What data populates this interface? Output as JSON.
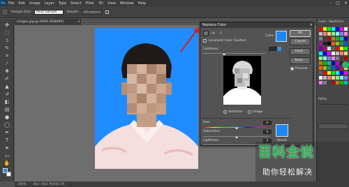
{
  "app": {
    "logo": "Ps"
  },
  "menu": [
    "File",
    "Edit",
    "Image",
    "Layer",
    "Type",
    "Select",
    "Filter",
    "3D",
    "View",
    "Window",
    "Help"
  ],
  "window_controls": [
    "–",
    "□",
    "×"
  ],
  "options_bar": {
    "sample_size_label": "Sample Size:",
    "sample_size_value": "Point Sample",
    "sample_label": "Sample:",
    "sample_value": "All Layers"
  },
  "document": {
    "tab_title": "images.jpg @ 200% (RGB/8#)",
    "zoom": "200%",
    "doc_size": "Doc: 643.7K/643.7K"
  },
  "dialog": {
    "title": "Replace Color",
    "localized_label": "Localized Color Clusters",
    "color_label": "Color:",
    "fuzziness_label": "Fuzziness:",
    "fuzziness_value": "",
    "selection_label": "Selection",
    "image_label": "Image",
    "replacement": {
      "hue_label": "Hue:",
      "hue_value": "0",
      "saturation_label": "Saturation:",
      "saturation_value": "0",
      "lightness_label": "Lightness:",
      "lightness_value": "0",
      "result_label": "Result"
    },
    "buttons": {
      "ok": "OK",
      "cancel": "Cancel",
      "load": "Load...",
      "save": "Save..."
    },
    "preview_label": "Preview",
    "color_swatch": "#1e88f0",
    "result_swatch": "#1e88f0"
  },
  "panels": {
    "tabs": [
      "Color",
      "Swatches"
    ],
    "lower_tabs": [
      "Paths"
    ]
  },
  "colors": {
    "photo_background": "#1f8cff",
    "arrow": "#d42020"
  },
  "watermark": {
    "title": "百科全说",
    "subtitle": "助你轻松解决"
  }
}
